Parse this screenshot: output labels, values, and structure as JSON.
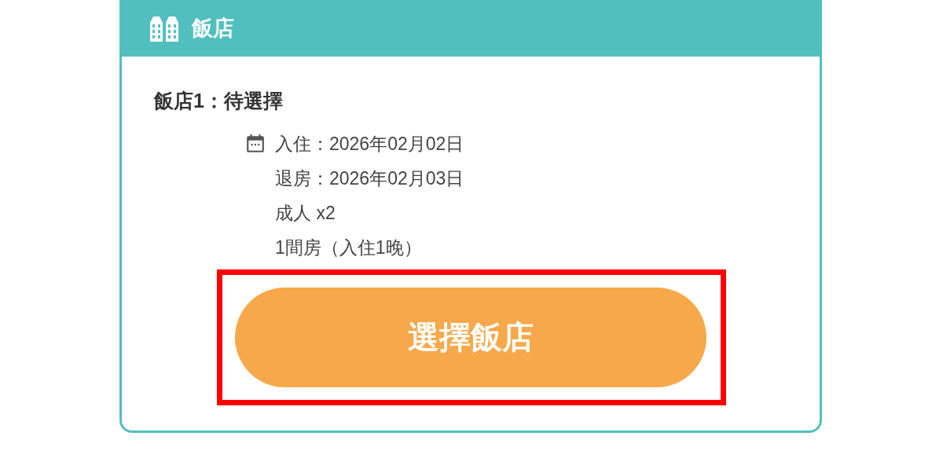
{
  "section": {
    "title": "飯店"
  },
  "hotel": {
    "title": "飯店1：待選擇",
    "details": [
      "入住：2026年02月02日",
      "退房：2026年02月03日",
      "成人 x2",
      "1間房（入住1晚）"
    ]
  },
  "button": {
    "label": "選擇飯店",
    "highlighted": true
  }
}
